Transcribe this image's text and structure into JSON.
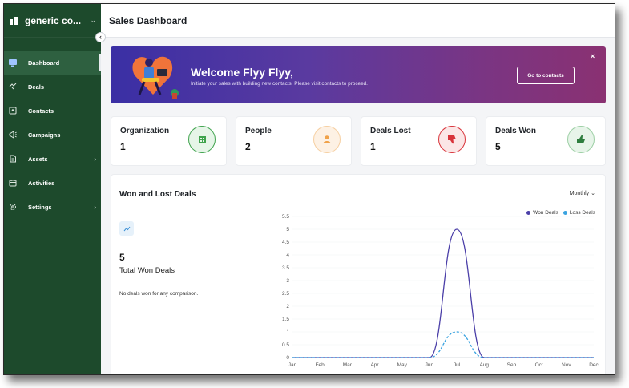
{
  "sidebar": {
    "workspace_name": "generic co...",
    "items": [
      {
        "label": "Dashboard",
        "icon": "dashboard-icon",
        "active": true
      },
      {
        "label": "Deals",
        "icon": "handshake-icon"
      },
      {
        "label": "Contacts",
        "icon": "contact-card-icon"
      },
      {
        "label": "Campaigns",
        "icon": "megaphone-icon"
      },
      {
        "label": "Assets",
        "icon": "document-icon",
        "has_submenu": true
      },
      {
        "label": "Activities",
        "icon": "calendar-icon"
      },
      {
        "label": "Settings",
        "icon": "gear-icon",
        "has_submenu": true
      }
    ]
  },
  "header": {
    "title": "Sales Dashboard"
  },
  "banner": {
    "title": "Welcome Flyy Flyy,",
    "subtitle": "Initiate your sales with building new contacts. Please visit contacts to proceed.",
    "button_label": "Go to contacts",
    "close_label": "×"
  },
  "stats": [
    {
      "label": "Organization",
      "value": "1",
      "icon": "building-icon",
      "color": "#3fa34d",
      "bg": "#e6f5e8"
    },
    {
      "label": "People",
      "value": "2",
      "icon": "person-icon",
      "color": "#f0a24a",
      "bg": "#fdf1e4"
    },
    {
      "label": "Deals Lost",
      "value": "1",
      "icon": "thumbs-down-icon",
      "color": "#d8333a",
      "bg": "#fbe6e6"
    },
    {
      "label": "Deals Won",
      "value": "5",
      "icon": "thumbs-up-icon",
      "color": "#2e7d3e",
      "bg": "#e7f4e9"
    }
  ],
  "panel": {
    "title": "Won and Lost Deals",
    "period": "Monthly",
    "total_value": "5",
    "total_label": "Total Won Deals",
    "note": "No deals won for any comparison."
  },
  "chart_data": {
    "type": "line",
    "categories": [
      "Jan",
      "Feb",
      "Mar",
      "Apr",
      "May",
      "Jun",
      "Jul",
      "Aug",
      "Sep",
      "Oct",
      "Nov",
      "Dec"
    ],
    "series": [
      {
        "name": "Won Deals",
        "values": [
          0,
          0,
          0,
          0,
          0,
          0,
          5,
          0,
          0,
          0,
          0,
          0
        ],
        "color": "#4b3fa8",
        "style": "solid"
      },
      {
        "name": "Loss Deals",
        "values": [
          0,
          0,
          0,
          0,
          0,
          0,
          1,
          0,
          0,
          0,
          0,
          0
        ],
        "color": "#3aa3e0",
        "style": "dashed"
      }
    ],
    "yticks": [
      "0",
      "0.5",
      "1",
      "1.5",
      "2",
      "2.5",
      "3",
      "3.5",
      "4",
      "4.5",
      "5",
      "5.5"
    ],
    "ylim": [
      0,
      5.5
    ],
    "legend_position": "top-right"
  }
}
